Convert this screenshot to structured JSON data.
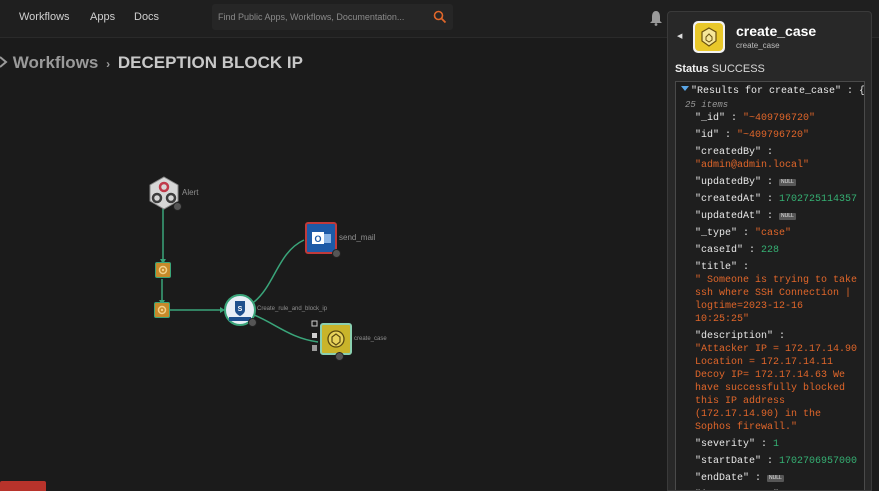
{
  "nav": {
    "workflows": "Workflows",
    "apps": "Apps",
    "docs": "Docs",
    "search_placeholder": "Find Public Apps, Workflows, Documentation..."
  },
  "breadcrumb": {
    "root": "Workflows",
    "separator": "›",
    "current": "DECEPTION BLOCK IP"
  },
  "canvas": {
    "nodes": {
      "alert": "Alert",
      "send_mail": "send_mail",
      "sophos_node": "Create_rule_and_block_ip",
      "create_case": "create_case"
    }
  },
  "panel": {
    "title": "create_case",
    "subtitle": "create_case",
    "status_label": "Status",
    "status_value": "SUCCESS",
    "results_header": "\"Results for create_case\"",
    "items_count": "25 items",
    "fields": [
      {
        "key": "\"_id\"",
        "type": "str",
        "value": "\"~409796720\""
      },
      {
        "key": "\"id\"",
        "type": "str",
        "value": "\"~409796720\""
      },
      {
        "key": "\"createdBy\"",
        "type": "str",
        "value": "\"admin@admin.local\"",
        "wrap": true
      },
      {
        "key": "\"updatedBy\"",
        "type": "null",
        "value": "NULL"
      },
      {
        "key": "\"createdAt\"",
        "type": "num",
        "value": "1702725114357"
      },
      {
        "key": "\"updatedAt\"",
        "type": "null",
        "value": "NULL"
      },
      {
        "key": "\"_type\"",
        "type": "str",
        "value": "\"case\""
      },
      {
        "key": "\"caseId\"",
        "type": "num",
        "value": "228"
      },
      {
        "key": "\"title\"",
        "type": "str",
        "value": "\" Someone is trying to take ssh where SSH Connection | logtime=2023-12-16 10:25:25\"",
        "wrap": true
      },
      {
        "key": "\"description\"",
        "type": "str",
        "value": "\"Attacker IP = 172.17.14.90 Location = 172.17.14.11 Decoy IP= 172.17.14.63 We have successfully blocked this IP address (172.17.14.90) in the Sophos firewall.\"",
        "wrap": true
      },
      {
        "key": "\"severity\"",
        "type": "num",
        "value": "1"
      },
      {
        "key": "\"startDate\"",
        "type": "num",
        "value": "1702706957000"
      },
      {
        "key": "\"endDate\"",
        "type": "null",
        "value": "NULL"
      },
      {
        "key": "\"impactStatus\"",
        "type": "null",
        "value": "NULL"
      }
    ]
  },
  "colors": {
    "edge": "#3aa57a",
    "accent_orange": "#e0662a",
    "number_green": "#35b073"
  }
}
